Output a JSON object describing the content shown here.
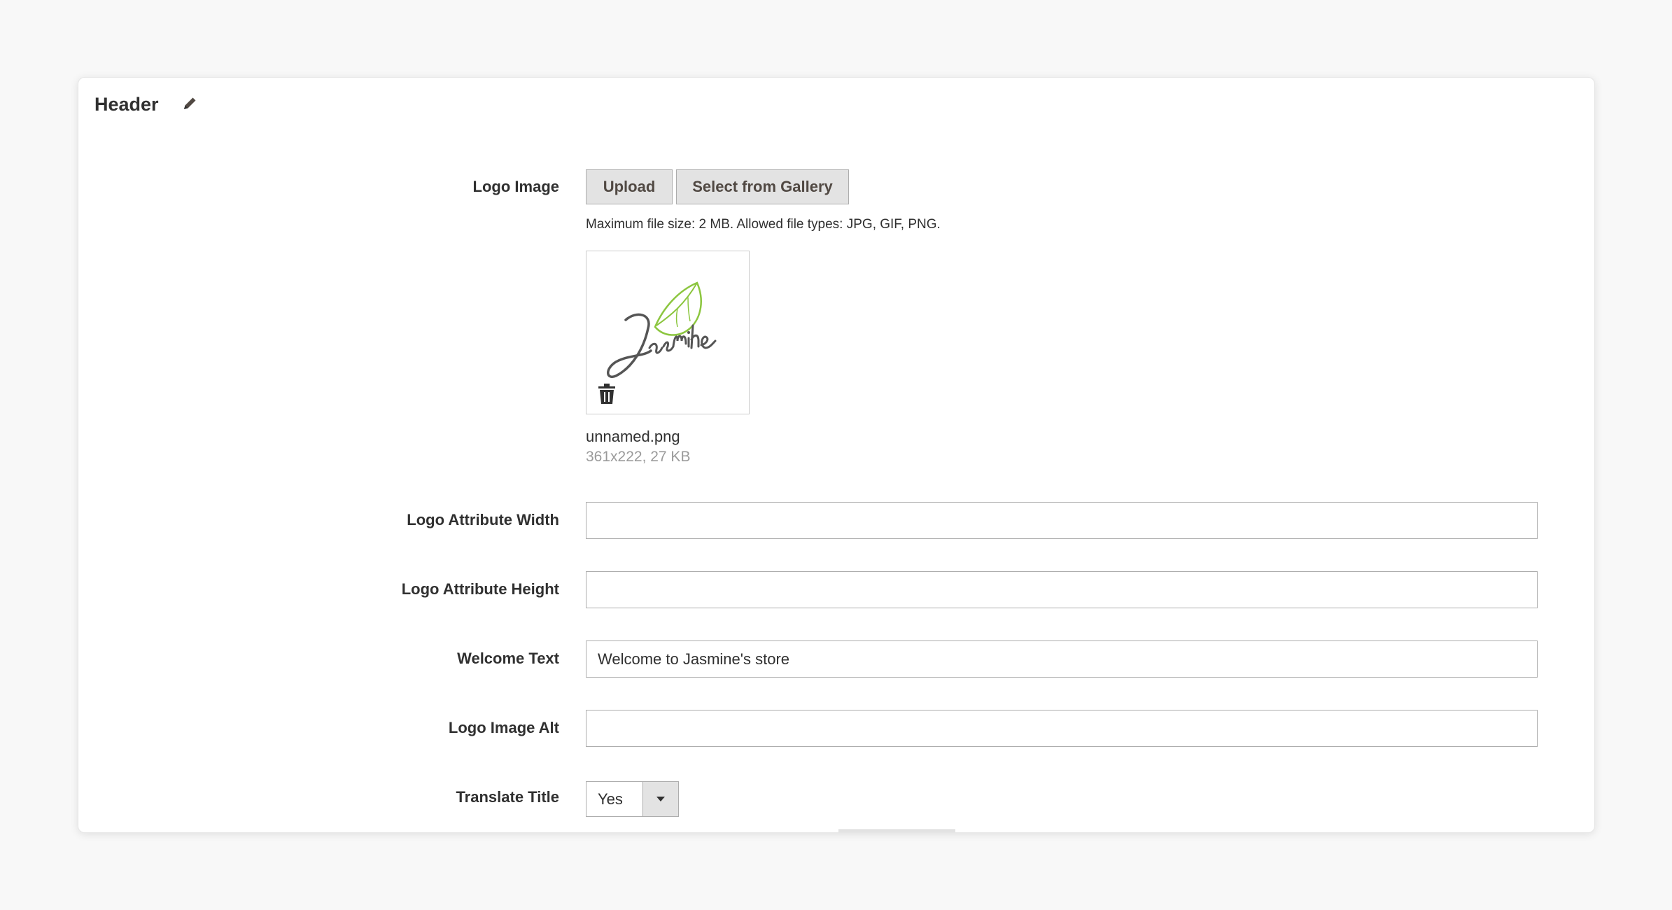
{
  "section": {
    "title": "Header",
    "edit_icon": "pencil-icon"
  },
  "logo_image": {
    "label": "Logo Image",
    "upload_label": "Upload",
    "gallery_label": "Select from Gallery",
    "note": "Maximum file size: 2 MB. Allowed file types: JPG, GIF, PNG.",
    "preview_icon": "jasmine-leaf-logo",
    "delete_icon": "trash-icon",
    "file_name": "unnamed.png",
    "file_meta": "361x222, 27 KB"
  },
  "logo_width": {
    "label": "Logo Attribute Width",
    "value": ""
  },
  "logo_height": {
    "label": "Logo Attribute Height",
    "value": ""
  },
  "welcome_text": {
    "label": "Welcome Text",
    "value": "Welcome to Jasmine's store"
  },
  "logo_alt": {
    "label": "Logo Image Alt",
    "value": ""
  },
  "translate_title": {
    "label": "Translate Title",
    "selected": "Yes"
  },
  "colors": {
    "page_bg": "#f8f8f8",
    "panel_bg": "#ffffff",
    "button_bg": "#e3e3e3",
    "border": "#adadad",
    "text": "#303030",
    "muted_text": "#9a9a9a",
    "leaf_green": "#8cc63f"
  }
}
